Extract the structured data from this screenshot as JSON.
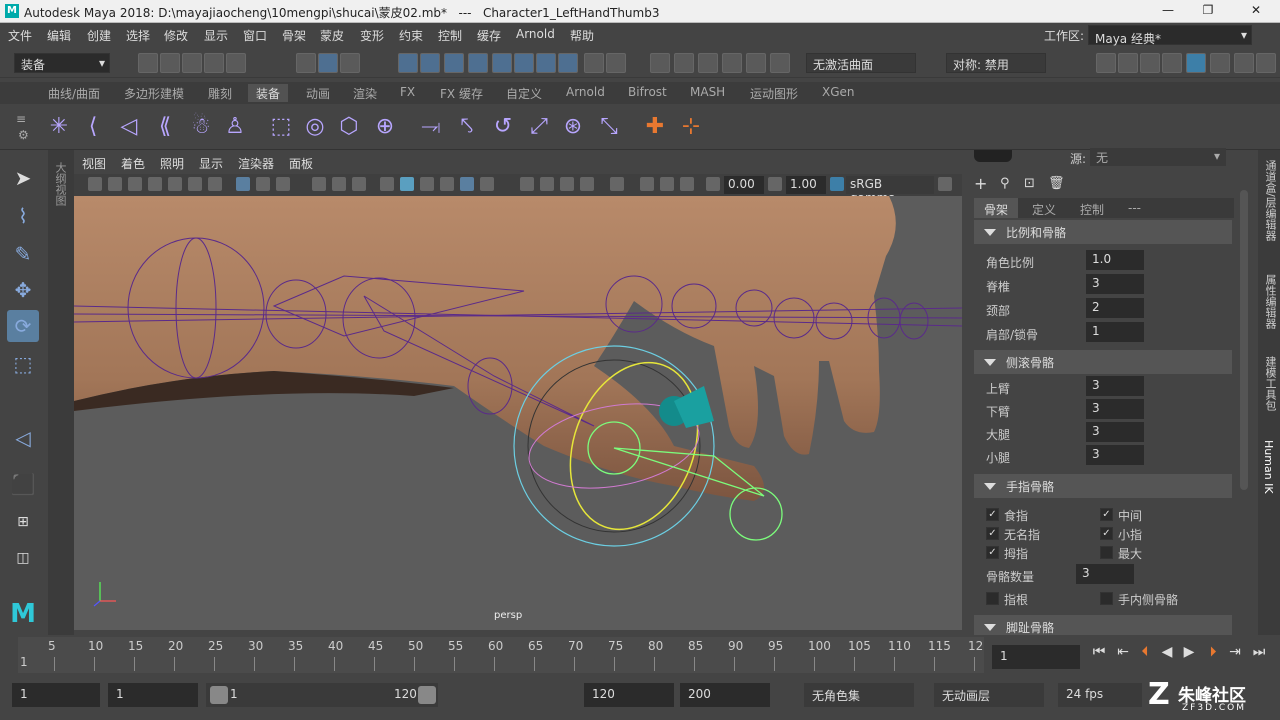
{
  "title": {
    "app": "Autodesk Maya 2018: D:\\mayajiaocheng\\10mengpi\\shucai\\蒙皮02.mb*",
    "sep": "---",
    "object": "Character1_LeftHandThumb3"
  },
  "menu": [
    "文件",
    "编辑",
    "创建",
    "选择",
    "修改",
    "显示",
    "窗口",
    "骨架",
    "蒙皮",
    "变形",
    "约束",
    "控制",
    "缓存",
    "Arnold",
    "帮助"
  ],
  "workspace": {
    "label": "工作区:",
    "value": "Maya 经典*"
  },
  "status": {
    "mode": "装备",
    "live_surface": "无激活曲面",
    "symmetry": "对称: 禁用"
  },
  "shelf_tabs": [
    "曲线/曲面",
    "多边形建模",
    "雕刻",
    "装备",
    "动画",
    "渲染",
    "FX",
    "FX 缓存",
    "自定义",
    "Arnold",
    "Bifrost",
    "MASH",
    "运动图形",
    "XGen"
  ],
  "shelf_active": "装备",
  "outliner_tab": "大纲视图",
  "viewport": {
    "menu": [
      "视图",
      "着色",
      "照明",
      "显示",
      "渲染器",
      "面板"
    ],
    "exposure": "0.00",
    "gamma": "1.00",
    "colorspace": "sRGB gamma",
    "camera": "persp"
  },
  "attr": {
    "source_label": "源:",
    "source_value": "无",
    "tabs": [
      "骨架",
      "定义",
      "控制",
      "---"
    ],
    "sec_scale": "比例和骨骼",
    "rows_scale": [
      {
        "label": "角色比例",
        "value": "1.0"
      },
      {
        "label": "脊椎",
        "value": "3"
      },
      {
        "label": "颈部",
        "value": "2"
      },
      {
        "label": "肩部/锁骨",
        "value": "1"
      }
    ],
    "sec_roll": "侧滚骨骼",
    "rows_roll": [
      {
        "label": "上臂",
        "value": "3"
      },
      {
        "label": "下臂",
        "value": "3"
      },
      {
        "label": "大腿",
        "value": "3"
      },
      {
        "label": "小腿",
        "value": "3"
      }
    ],
    "sec_fingers": "手指骨骼",
    "fingers": [
      {
        "label": "食指",
        "checked": true
      },
      {
        "label": "中间",
        "checked": true
      },
      {
        "label": "无名指",
        "checked": true
      },
      {
        "label": "小指",
        "checked": true
      },
      {
        "label": "拇指",
        "checked": true
      },
      {
        "label": "最大",
        "checked": false
      }
    ],
    "count_label": "骨骼数量",
    "count_value": "3",
    "base_label": "指根",
    "inner_label": "手内侧骨骼",
    "sec_foot": "脚趾骨骼"
  },
  "right_tabs": [
    "通道盒/层编辑器",
    "属性编辑器",
    "建模工具包",
    "Human IK"
  ],
  "timeline": {
    "ticks": [
      "5",
      "10",
      "15",
      "20",
      "25",
      "30",
      "35",
      "40",
      "45",
      "50",
      "55",
      "60",
      "65",
      "70",
      "75",
      "80",
      "85",
      "90",
      "95",
      "100",
      "105",
      "110",
      "115",
      "12"
    ],
    "first_tick": "1",
    "current_frame": "1"
  },
  "range": {
    "start": "1",
    "anim_start": "1",
    "range_start": "1",
    "range_end": "120",
    "end": "120",
    "anim_end": "200",
    "char_set": "无角色集",
    "anim_layer": "无动画层",
    "fps": "24 fps"
  },
  "watermark": {
    "text": "朱峰社区",
    "url": "ZF3D.COM"
  },
  "colors": {
    "accent": "#5a7fa0",
    "joint": "#5a2a8a",
    "ik": "#7cfc7c",
    "skin": "#b88a6a"
  }
}
